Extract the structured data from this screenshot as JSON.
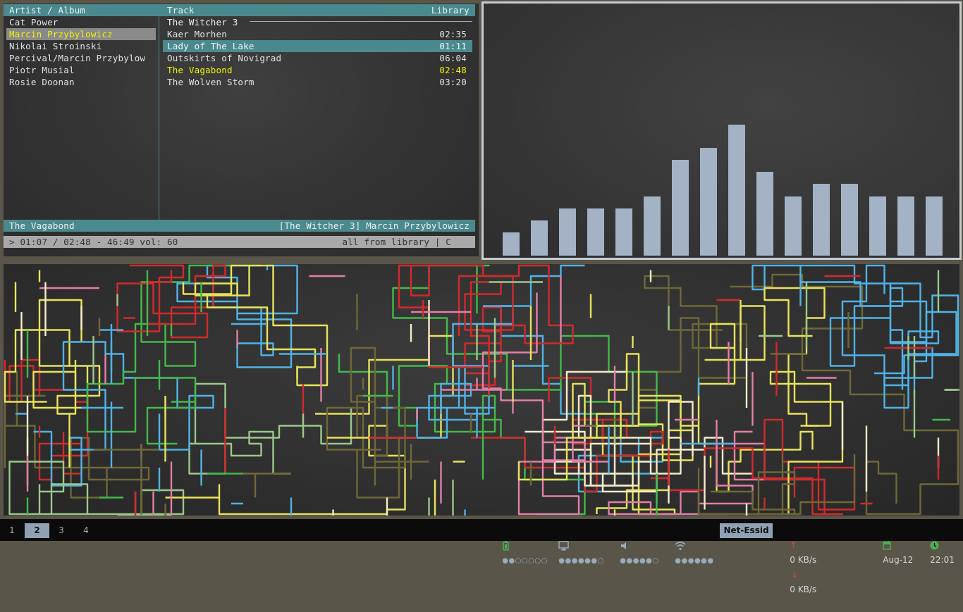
{
  "player": {
    "headers": {
      "artist_album": "Artist / Album",
      "track": "Track",
      "view": "Library"
    },
    "artists": [
      "Cat Power",
      "Marcin Przybylowicz",
      "Nikolai Stroinski",
      "Percival/Marcin Przybylow",
      "Piotr Musial",
      "Rosie Doonan"
    ],
    "selected_artist_index": 1,
    "album_title": "The Witcher 3",
    "tracks": [
      {
        "title": "Kaer Morhen",
        "duration": "02:35"
      },
      {
        "title": "Lady of The Lake",
        "duration": "01:11"
      },
      {
        "title": "Outskirts of Novigrad",
        "duration": "06:04"
      },
      {
        "title": "The Vagabond",
        "duration": "02:48"
      },
      {
        "title": "The Wolven Storm",
        "duration": "03:20"
      }
    ],
    "selected_track_index": 1,
    "playing_track_index": 3,
    "now_playing": {
      "title": "The Vagabond",
      "info": "[The Witcher 3] Marcin Przybylowicz"
    },
    "status": {
      "left": "> 01:07 / 02:48 - 46:49 vol: 60",
      "right": "all from library | C"
    },
    "colors": {
      "accent": "#4a8a8e",
      "highlight": "#f3f300"
    }
  },
  "visualizer": {
    "bar_levels": [
      0.18,
      0.27,
      0.36,
      0.36,
      0.36,
      0.45,
      0.73,
      0.82,
      1.0,
      0.64,
      0.45,
      0.55,
      0.55,
      0.45,
      0.45,
      0.45
    ],
    "bar_color": "#a3b2c5"
  },
  "pipes": {
    "colors": [
      "#4fb3e6",
      "#e8e35a",
      "#f3ecc7",
      "#e27fa8",
      "#d22a2a",
      "#43b94a",
      "#9ac98a",
      "#6e6837"
    ]
  },
  "statusbar": {
    "workspaces": [
      "1",
      "2",
      "3",
      "4"
    ],
    "active_workspace": 1,
    "battery_dots": "●●○○○○○",
    "display_dots": "●●●●●●○",
    "volume_dots": "●●●●●○",
    "wifi_dots": "●●●●●●",
    "essid": "Net-Essid",
    "upload": "0 KB/s",
    "download": "0 KB/s",
    "date": "Aug-12",
    "time": "22:01",
    "icons": [
      "battery-icon",
      "monitor-icon",
      "speaker-icon",
      "wifi-icon",
      "upload-arrow-icon",
      "download-arrow-icon",
      "calendar-icon",
      "clock-icon"
    ]
  }
}
